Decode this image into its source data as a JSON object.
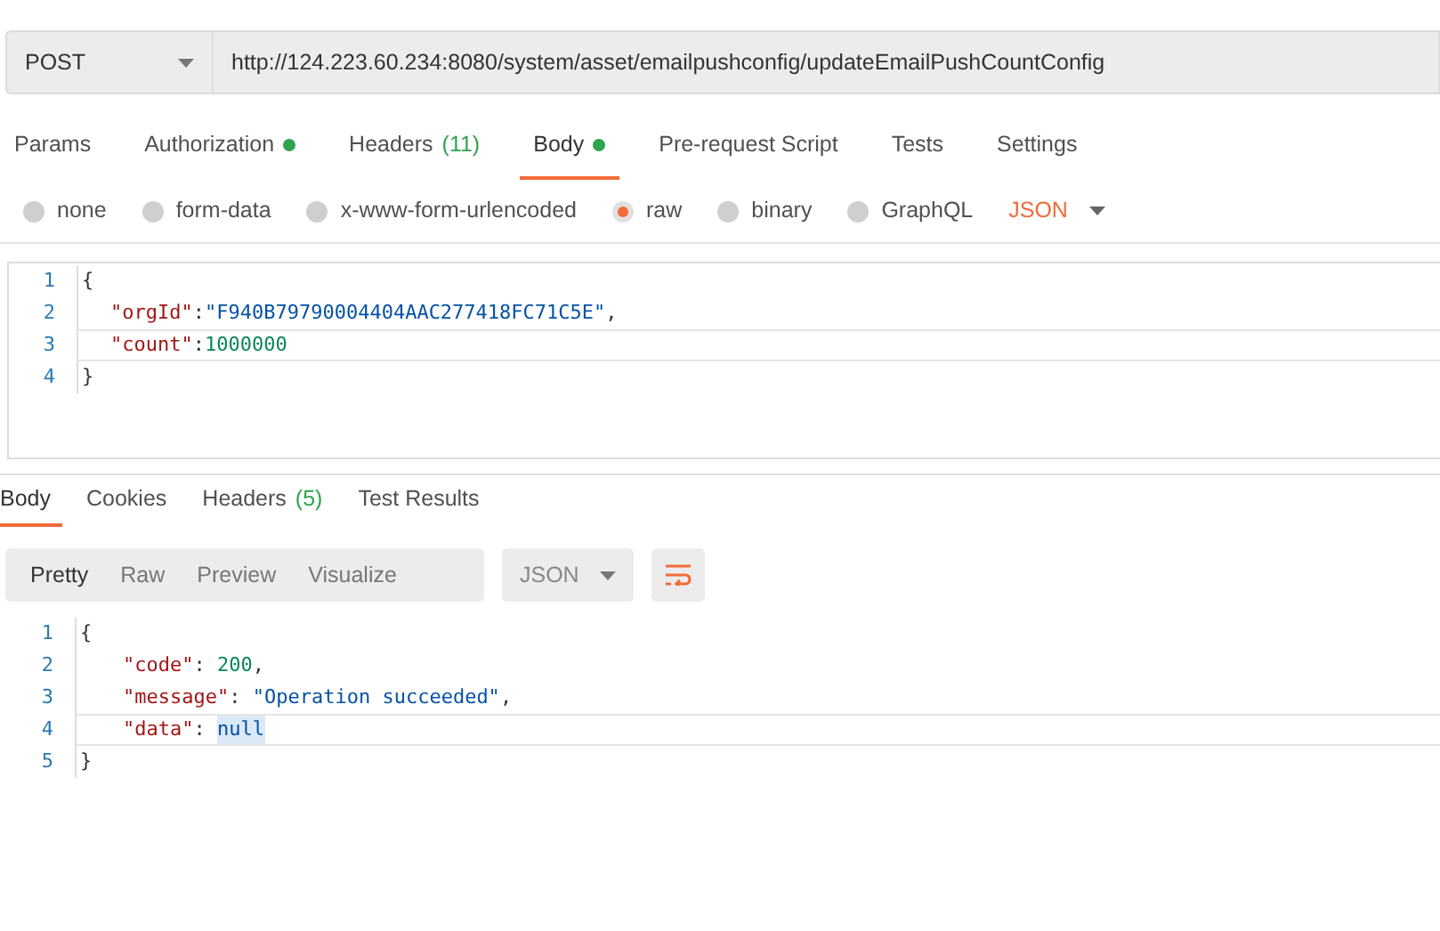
{
  "request": {
    "method": "POST",
    "url": "http://124.223.60.234:8080/system/asset/emailpushconfig/updateEmailPushCountConfig"
  },
  "tabs": [
    {
      "label": "Params",
      "selected": false
    },
    {
      "label": "Authorization",
      "selected": false,
      "dot": true
    },
    {
      "label": "Headers",
      "count": "(11)",
      "selected": false
    },
    {
      "label": "Body",
      "selected": true,
      "dot": true
    },
    {
      "label": "Pre-request Script",
      "selected": false
    },
    {
      "label": "Tests",
      "selected": false
    },
    {
      "label": "Settings",
      "selected": false
    }
  ],
  "body_types": [
    {
      "label": "none",
      "selected": false
    },
    {
      "label": "form-data",
      "selected": false
    },
    {
      "label": "x-www-form-urlencoded",
      "selected": false
    },
    {
      "label": "raw",
      "selected": true
    },
    {
      "label": "binary",
      "selected": false
    },
    {
      "label": "GraphQL",
      "selected": false
    }
  ],
  "raw_format": "JSON",
  "request_body": [
    {
      "number": "1",
      "current": false,
      "indent": false,
      "tokens": [
        {
          "kind": "punct",
          "text": "{"
        }
      ]
    },
    {
      "number": "2",
      "current": false,
      "indent": true,
      "tokens": [
        {
          "kind": "key",
          "text": "\"orgId\""
        },
        {
          "kind": "punct",
          "text": ":"
        },
        {
          "kind": "string",
          "text": "\"F940B79790004404AAC277418FC71C5E\""
        },
        {
          "kind": "punct",
          "text": ","
        }
      ]
    },
    {
      "number": "3",
      "current": true,
      "indent": true,
      "tokens": [
        {
          "kind": "key",
          "text": "\"count\""
        },
        {
          "kind": "punct",
          "text": ":"
        },
        {
          "kind": "number",
          "text": "1000000"
        }
      ]
    },
    {
      "number": "4",
      "current": false,
      "indent": false,
      "tokens": [
        {
          "kind": "punct",
          "text": "}"
        }
      ]
    }
  ],
  "response_tabs": [
    {
      "label": "Body",
      "selected": true
    },
    {
      "label": "Cookies",
      "selected": false
    },
    {
      "label": "Headers",
      "count": "(5)",
      "selected": false
    },
    {
      "label": "Test Results",
      "selected": false
    }
  ],
  "view_modes": [
    {
      "label": "Pretty",
      "selected": true
    },
    {
      "label": "Raw",
      "selected": false
    },
    {
      "label": "Preview",
      "selected": false
    },
    {
      "label": "Visualize",
      "selected": false
    }
  ],
  "response_format": "JSON",
  "response_body": [
    {
      "number": "1",
      "current": false,
      "indent": false,
      "tokens": [
        {
          "kind": "punct",
          "text": "{"
        }
      ]
    },
    {
      "number": "2",
      "current": false,
      "indent": true,
      "tokens": [
        {
          "kind": "key",
          "text": "\"code\""
        },
        {
          "kind": "punct",
          "text": ": "
        },
        {
          "kind": "number",
          "text": "200"
        },
        {
          "kind": "punct",
          "text": ","
        }
      ]
    },
    {
      "number": "3",
      "current": false,
      "indent": true,
      "tokens": [
        {
          "kind": "key",
          "text": "\"message\""
        },
        {
          "kind": "punct",
          "text": ": "
        },
        {
          "kind": "string",
          "text": "\"Operation succeeded\""
        },
        {
          "kind": "punct",
          "text": ","
        }
      ]
    },
    {
      "number": "4",
      "current": true,
      "indent": true,
      "tokens": [
        {
          "kind": "key",
          "text": "\"data\""
        },
        {
          "kind": "punct",
          "text": ": "
        },
        {
          "kind": "literal",
          "text": "null",
          "highlighted": true
        }
      ]
    },
    {
      "number": "5",
      "current": false,
      "indent": false,
      "tokens": [
        {
          "kind": "punct",
          "text": "}"
        }
      ]
    }
  ]
}
